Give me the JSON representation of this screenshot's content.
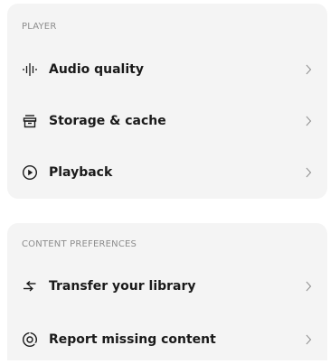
{
  "sections": [
    {
      "title": "PLAYER",
      "items": [
        {
          "label": "Audio quality",
          "icon": "audio-waveform-icon"
        },
        {
          "label": "Storage & cache",
          "icon": "storage-icon"
        },
        {
          "label": "Playback",
          "icon": "play-circle-icon"
        }
      ]
    },
    {
      "title": "CONTENT PREFERENCES",
      "items": [
        {
          "label": "Transfer your library",
          "icon": "transfer-arrows-icon"
        },
        {
          "label": "Report missing content",
          "icon": "report-content-icon"
        }
      ]
    }
  ],
  "colors": {
    "card_background": "#f4f4f4",
    "section_title": "#8c8c8c",
    "text": "#1a1a1a",
    "chevron": "#9a9a9a"
  }
}
